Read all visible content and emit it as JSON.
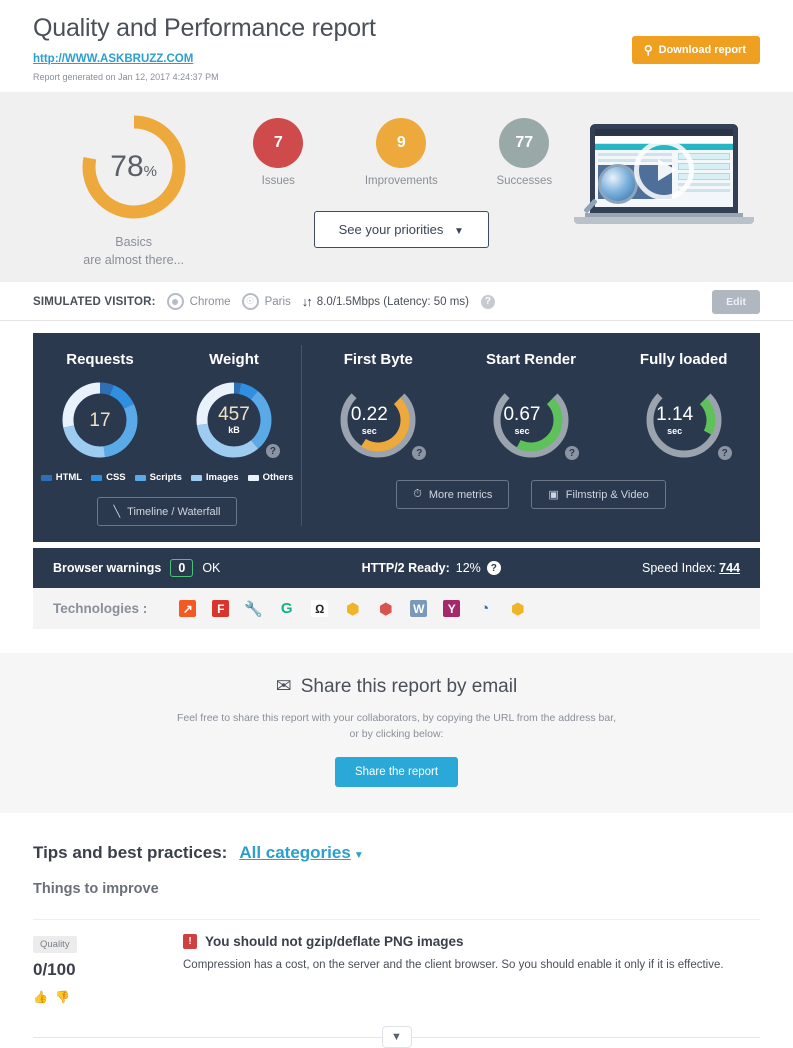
{
  "header": {
    "title": "Quality and Performance report",
    "url": "http://WWW.ASKBRUZZ.COM",
    "generated": "Report generated on Jan 12, 2017 4:24:37 PM",
    "download_label": "Download report",
    "download_icon": "pdf-icon"
  },
  "summary": {
    "score": "78",
    "score_unit": "%",
    "score_color": "#eda93b",
    "caption_line1": "Basics",
    "caption_line2": "are almost there...",
    "counters": [
      {
        "value": "7",
        "label": "Issues",
        "color": "#cf4a4a"
      },
      {
        "value": "9",
        "label": "Improvements",
        "color": "#eda93b"
      },
      {
        "value": "77",
        "label": "Successes",
        "color": "#98a9a8"
      }
    ],
    "priorities_label": "See your priorities",
    "priorities_caret": "chevron-down-icon",
    "video_alt": "play-video"
  },
  "visitor": {
    "label": "SIMULATED VISITOR:",
    "browser": "Chrome",
    "location": "Paris",
    "network": "8.0/1.5Mbps (Latency: 50 ms)",
    "help": "?",
    "edit_label": "Edit"
  },
  "metrics": {
    "columns": {
      "requests": "Requests",
      "weight": "Weight",
      "first_byte": "First Byte",
      "start_render": "Start Render",
      "fully_loaded": "Fully loaded"
    },
    "requests_value": "17",
    "weight_value": "457",
    "weight_unit": "kB",
    "legend": [
      {
        "label": "HTML",
        "color": "#2f6fb5"
      },
      {
        "label": "CSS",
        "color": "#2f8fe0"
      },
      {
        "label": "Scripts",
        "color": "#5aaae8"
      },
      {
        "label": "Images",
        "color": "#9ecbf0"
      },
      {
        "label": "Others",
        "color": "#e9f2fb"
      }
    ],
    "gauges": [
      {
        "key": "first_byte",
        "value": "0.22",
        "unit": "sec",
        "color": "#eda93b",
        "pct": 62
      },
      {
        "key": "start_render",
        "value": "0.67",
        "unit": "sec",
        "color": "#5fc159",
        "pct": 60
      },
      {
        "key": "fully_loaded",
        "value": "1.14",
        "unit": "sec",
        "color": "#5fc159",
        "pct": 27
      }
    ],
    "timeline_label": "Timeline / Waterfall",
    "more_metrics_label": "More metrics",
    "filmstrip_label": "Filmstrip & Video",
    "help": "?"
  },
  "warnings": {
    "label": "Browser warnings",
    "count": "0",
    "status": "OK",
    "http2_label": "HTTP/2 Ready:",
    "http2_value": "12%",
    "speed_index_label": "Speed Index:",
    "speed_index_value": "744",
    "help": "?"
  },
  "technologies": {
    "label": "Technologies :",
    "items": [
      {
        "name": "analytics-icon",
        "glyph": "↗",
        "bg": "#f15a22",
        "fg": "#ffffff"
      },
      {
        "name": "font-awesome-icon",
        "glyph": "F",
        "bg": "#d9352c",
        "fg": "#ffffff"
      },
      {
        "name": "wrench-tool-icon",
        "glyph": "🔧",
        "bg": "transparent",
        "fg": "#3f5068"
      },
      {
        "name": "grammarly-icon",
        "glyph": "G",
        "bg": "transparent",
        "fg": "#11b48a"
      },
      {
        "name": "opencart-icon",
        "glyph": "Ω",
        "bg": "#ffffff",
        "fg": "#222222"
      },
      {
        "name": "package-box-icon",
        "glyph": "⬢",
        "bg": "transparent",
        "fg": "#f0b429"
      },
      {
        "name": "ruby-gem-icon",
        "glyph": "⬢",
        "bg": "transparent",
        "fg": "#d9534f"
      },
      {
        "name": "wordpress-icon",
        "glyph": "W",
        "bg": "#7a98b8",
        "fg": "#ffffff"
      },
      {
        "name": "yoast-seo-icon",
        "glyph": "Y",
        "bg": "#a4286a",
        "fg": "#ffffff"
      },
      {
        "name": "jquery-icon",
        "glyph": "◔",
        "bg": "transparent",
        "fg": "#2c6ea8"
      },
      {
        "name": "package-box2-icon",
        "glyph": "⬢",
        "bg": "transparent",
        "fg": "#f0b429"
      }
    ]
  },
  "share": {
    "title": "Share this report by email",
    "icon": "envelope-icon",
    "sub_line1": "Feel free to share this report with your collaborators, by copying the URL from the address bar,",
    "sub_line2": "or by clicking below:",
    "button_label": "Share the report"
  },
  "tips": {
    "title": "Tips and best practices:",
    "category": "All categories",
    "subtitle": "Things to improve",
    "rows": [
      {
        "tag": "Quality",
        "score": "0/100",
        "title": "You should not gzip/deflate PNG images",
        "description": "Compression has a cost, on the server and the client browser. So you should enable it only if it is effective."
      }
    ],
    "expander_icon": "chevron-down-icon"
  }
}
